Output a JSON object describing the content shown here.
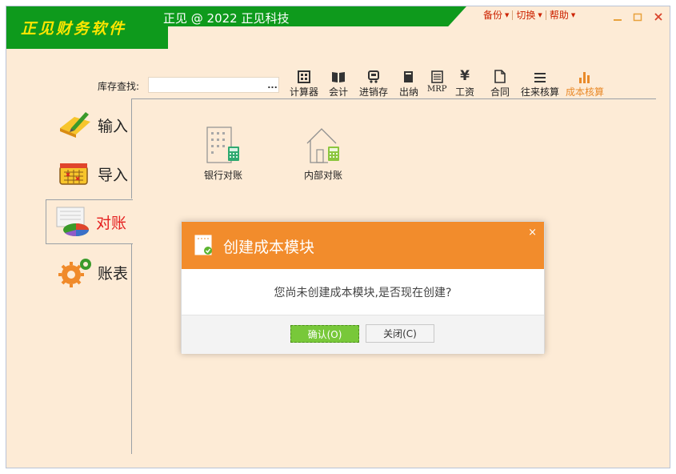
{
  "app": {
    "logo_text": "正见财务软件",
    "title": "正见 @ 2022 正见科技"
  },
  "top_menu": [
    {
      "label": "备份"
    },
    {
      "label": "切换"
    },
    {
      "label": "帮助"
    }
  ],
  "search": {
    "label": "库存查找:",
    "value": "",
    "more": "..."
  },
  "toolbar": {
    "active": "成本核算",
    "items": [
      {
        "label": "计算器",
        "icon": "calculator-icon"
      },
      {
        "label": "会计",
        "icon": "book-icon"
      },
      {
        "label": "进销存",
        "icon": "cart-icon"
      },
      {
        "label": "出纳",
        "icon": "notebook-icon"
      },
      {
        "label": "MRP",
        "icon": "mrp-icon"
      },
      {
        "label": "工资",
        "icon": "yen-icon"
      },
      {
        "label": "合同",
        "icon": "document-icon"
      },
      {
        "label": "往来核算",
        "icon": "list-icon"
      },
      {
        "label": "成本核算",
        "icon": "bar-chart-icon"
      }
    ]
  },
  "nav": {
    "active": "对账",
    "items": [
      {
        "label": "输入",
        "icon": "pencil-paper-icon"
      },
      {
        "label": "导入",
        "icon": "calendar-icon"
      },
      {
        "label": "对账",
        "icon": "pie-chart-icon"
      },
      {
        "label": "账表",
        "icon": "gears-icon"
      }
    ]
  },
  "content": {
    "items": [
      {
        "label": "银行对账",
        "icon": "bank-building-icon"
      },
      {
        "label": "内部对账",
        "icon": "house-icon"
      }
    ]
  },
  "dialog": {
    "title": "创建成本模块",
    "message": "您尚未创建成本模块,是否现在创建?",
    "ok_label": "确认(O)",
    "cancel_label": "关闭(C)",
    "close_glyph": "×"
  },
  "colors": {
    "brand_green": "#0e9a1c",
    "logo_yellow": "#ffe600",
    "dialog_orange": "#f28c2c",
    "ok_green": "#78c83a",
    "active_red": "#e52020",
    "active_tool_orange": "#e98a2a",
    "background": "#fdebd6"
  }
}
